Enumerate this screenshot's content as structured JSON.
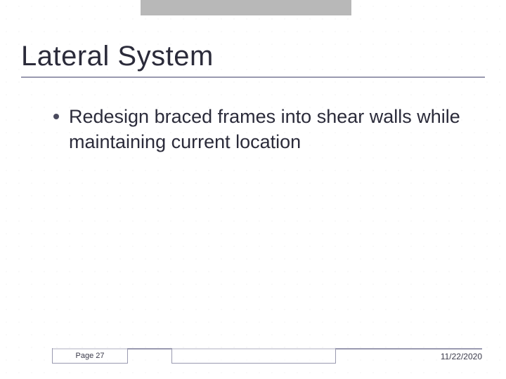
{
  "slide": {
    "title": "Lateral System",
    "bullets": [
      "Redesign braced frames into shear walls while maintaining current location"
    ]
  },
  "footer": {
    "page_label": "Page 27",
    "date": "11/22/2020"
  }
}
